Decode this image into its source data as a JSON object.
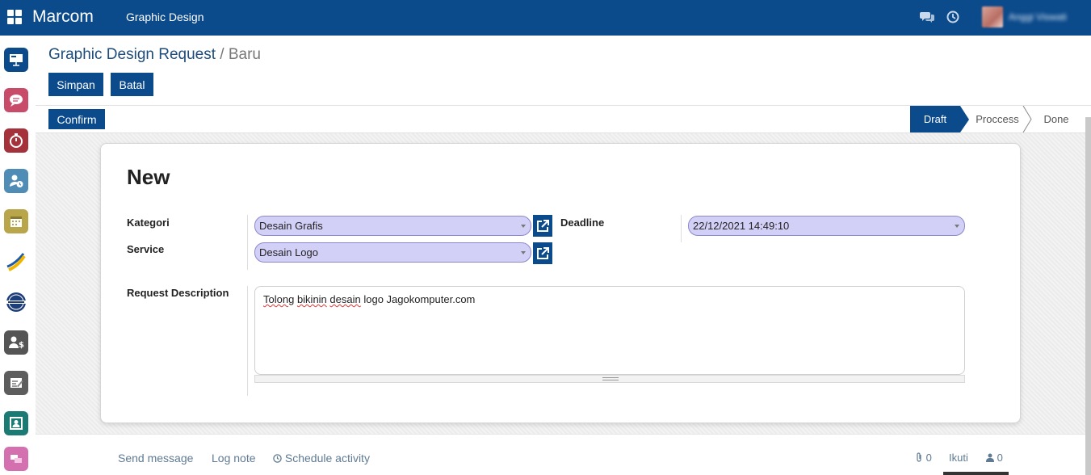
{
  "navbar": {
    "brand": "Marcom",
    "menu": "Graphic Design",
    "user_name": "Anggi Viswati"
  },
  "sidebar": {
    "apps": [
      {
        "name": "presentation-app-icon",
        "color": "#0b4a8b"
      },
      {
        "name": "discuss-app-icon",
        "color": "#c94b6a"
      },
      {
        "name": "timer-app-icon",
        "color": "#a5323a"
      },
      {
        "name": "employees-app-icon",
        "color": "#4f8cb6"
      },
      {
        "name": "calendar-app-icon",
        "color": "#b9a54a"
      },
      {
        "name": "brand-logo-app-icon",
        "color": "#f1b500"
      },
      {
        "name": "badge-app-icon",
        "color": "#1e3e7a"
      },
      {
        "name": "payroll-app-icon",
        "color": "#555555"
      },
      {
        "name": "notes-app-icon",
        "color": "#5d5d5d"
      },
      {
        "name": "contacts-app-icon",
        "color": "#1b7a74"
      },
      {
        "name": "workspace-app-icon",
        "color": "#d46fb0"
      }
    ]
  },
  "breadcrumb": {
    "parent": "Graphic Design Request",
    "separator": " / ",
    "current": "Baru"
  },
  "buttons": {
    "save": "Simpan",
    "cancel": "Batal",
    "confirm": "Confirm"
  },
  "statusbar": {
    "stages": [
      "Draft",
      "Proccess",
      "Done"
    ],
    "active": "Draft"
  },
  "form": {
    "title": "New",
    "kategori_label": "Kategori",
    "kategori_value": "Desain Grafis",
    "service_label": "Service",
    "service_value": "Desain Logo",
    "deadline_label": "Deadline",
    "deadline_value": "22/12/2021 14:49:10",
    "description_label": "Request Description",
    "description_words": [
      "Tolong",
      "bikinin",
      "desain",
      "logo Jagokomputer.com"
    ]
  },
  "chatter": {
    "send_message": "Send message",
    "log_note": "Log note",
    "schedule_activity": "Schedule activity",
    "attachments_count": "0",
    "follow": "Ikuti",
    "followers_count": "0"
  },
  "colors": {
    "primary": "#0b4a8b",
    "field_bg": "#d3d0f8"
  }
}
